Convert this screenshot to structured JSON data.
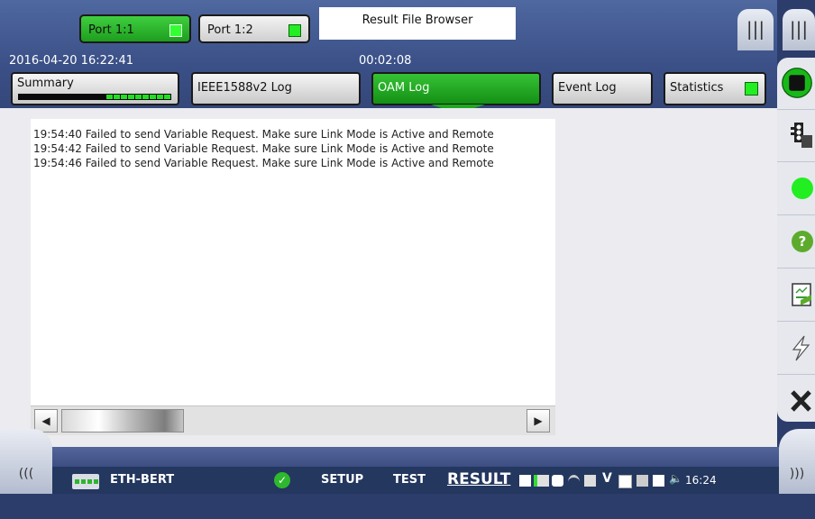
{
  "ports": [
    {
      "label": "Port 1:1",
      "active": true
    },
    {
      "label": "Port 1:2",
      "active": false
    }
  ],
  "result_file_browser": "Result File Browser",
  "datetime": "2016-04-20 16:22:41",
  "elapsed": "00:02:08",
  "tabs": {
    "summary": "Summary",
    "ieee": "IEEE1588v2 Log",
    "oam": "OAM Log",
    "event": "Event Log",
    "statistics": "Statistics"
  },
  "log_lines": [
    "19:54:40 Failed to send Variable Request. Make sure Link Mode is Active and Remote",
    "19:54:42 Failed to send Variable Request. Make sure Link Mode is Active and Remote",
    "19:54:46 Failed to send Variable Request. Make sure Link Mode is Active and Remote"
  ],
  "taskbar": {
    "app": "ETH-BERT",
    "setup": "SETUP",
    "test": "TEST",
    "result": "RESULT",
    "clock": "16:24"
  },
  "icons": {
    "corner_left": "|||",
    "corner_right": "|||",
    "nav_left": "(((",
    "nav_right": ")))"
  },
  "colors": {
    "active_tab": "#1fa81f",
    "header": "#3b5087",
    "taskbar": "#24375f"
  }
}
